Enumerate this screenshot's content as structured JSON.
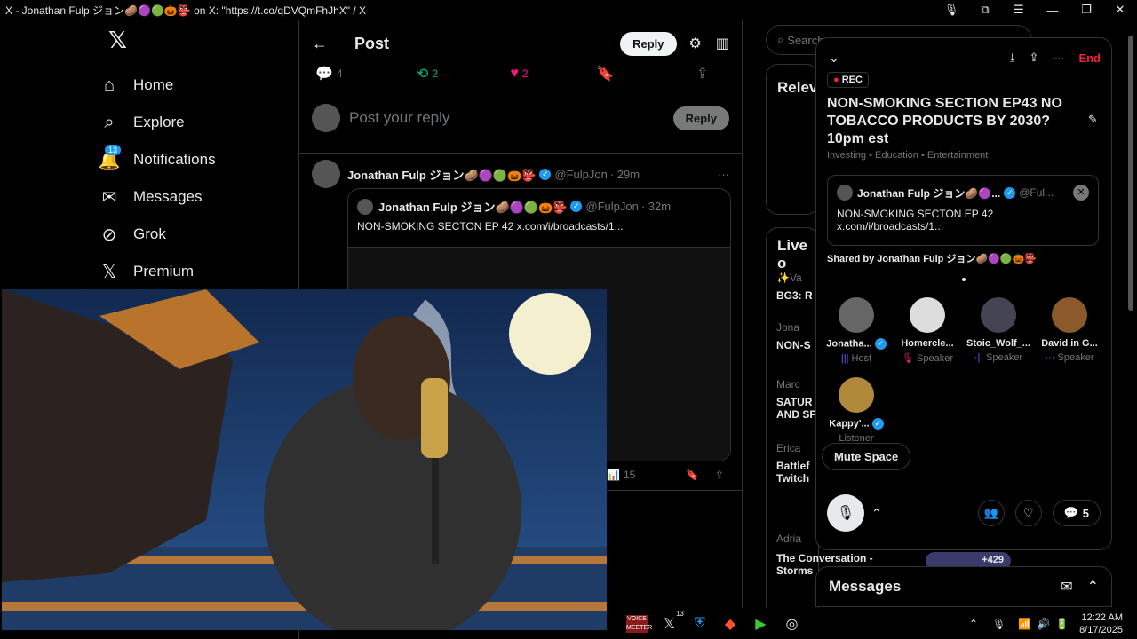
{
  "window": {
    "title": "X - Jonathan Fulp ジョン🥔🟣🟢🎃👺 on X: \"https://t.co/qDVQmFhJhX\" / X",
    "controls": [
      "—",
      "❐",
      "✕"
    ]
  },
  "nav": {
    "items": [
      {
        "label": "Home",
        "icon": "home-icon"
      },
      {
        "label": "Explore",
        "icon": "search-icon"
      },
      {
        "label": "Notifications",
        "icon": "bell-icon",
        "badge": "13"
      },
      {
        "label": "Messages",
        "icon": "mail-icon"
      },
      {
        "label": "Grok",
        "icon": "grok-icon"
      },
      {
        "label": "Premium",
        "icon": "x-icon"
      }
    ]
  },
  "post_header": {
    "title": "Post",
    "reply_button": "Reply"
  },
  "actions": {
    "replies": "4",
    "reposts": "2",
    "likes": "2"
  },
  "reply_box": {
    "placeholder": "Post your reply",
    "button": "Reply"
  },
  "reply": {
    "author": "Jonathan Fulp ジョン🥔🟣🟢🎃👺",
    "handle": "@FulpJon",
    "time": "· 29m",
    "quoted": {
      "author": "Jonathan Fulp ジョン🥔🟣🟢🎃👺",
      "handle": "@FulpJon",
      "time": "· 32m",
      "text": "NON-SMOKING SECTON EP 42 x.com/i/broadcasts/1..."
    },
    "views": "15"
  },
  "right": {
    "search_placeholder": "Search",
    "relevant": "Relev",
    "live_on": "Live o",
    "trends": [
      {
        "author": "✨Va",
        "text": "BG3: R"
      },
      {
        "author": "Jona",
        "text": "NON-S"
      },
      {
        "author": "Marc",
        "text": "SATUR\nAND SP"
      },
      {
        "author": "Erica",
        "text": "Battlef\nTwitch"
      },
      {
        "author": "Adria",
        "text": "The Conversation -\nStorms"
      }
    ],
    "listeners_extra": "+429"
  },
  "space": {
    "rec": "REC",
    "end": "End",
    "title": "NON-SMOKING SECTION EP43 NO TOBACCO PRODUCTS BY 2030? 10pm est",
    "topics": "Investing • Education • Entertainment",
    "pinned": {
      "author": "Jonathan Fulp ジョン🥔🟣...",
      "handle": "@Ful...",
      "text": "NON-SMOKING SECTON EP 42\nx.com/i/broadcasts/1..."
    },
    "shared_by": "Shared by Jonathan Fulp ジョン🥔🟣🟢🎃👺",
    "participants": [
      {
        "name": "Jonatha...",
        "role": "Host",
        "verified": true
      },
      {
        "name": "Homercle...",
        "role": "Speaker",
        "verified": false
      },
      {
        "name": "Stoic_Wolf_...",
        "role": "Speaker",
        "verified": false
      },
      {
        "name": "David in G...",
        "role": "Speaker",
        "verified": false
      },
      {
        "name": "Kappy'...",
        "role": "Listener",
        "verified": true
      }
    ],
    "mute_button": "Mute Space",
    "comments": "5"
  },
  "messages_bar": {
    "label": "Messages"
  },
  "taskbar": {
    "time": "12:22 AM",
    "date": "8/17/2025",
    "x_badge": "13"
  },
  "colors": {
    "accent": "#1d9bf0",
    "repost": "#00ba7c",
    "like": "#f91880",
    "end": "#f4212e"
  }
}
